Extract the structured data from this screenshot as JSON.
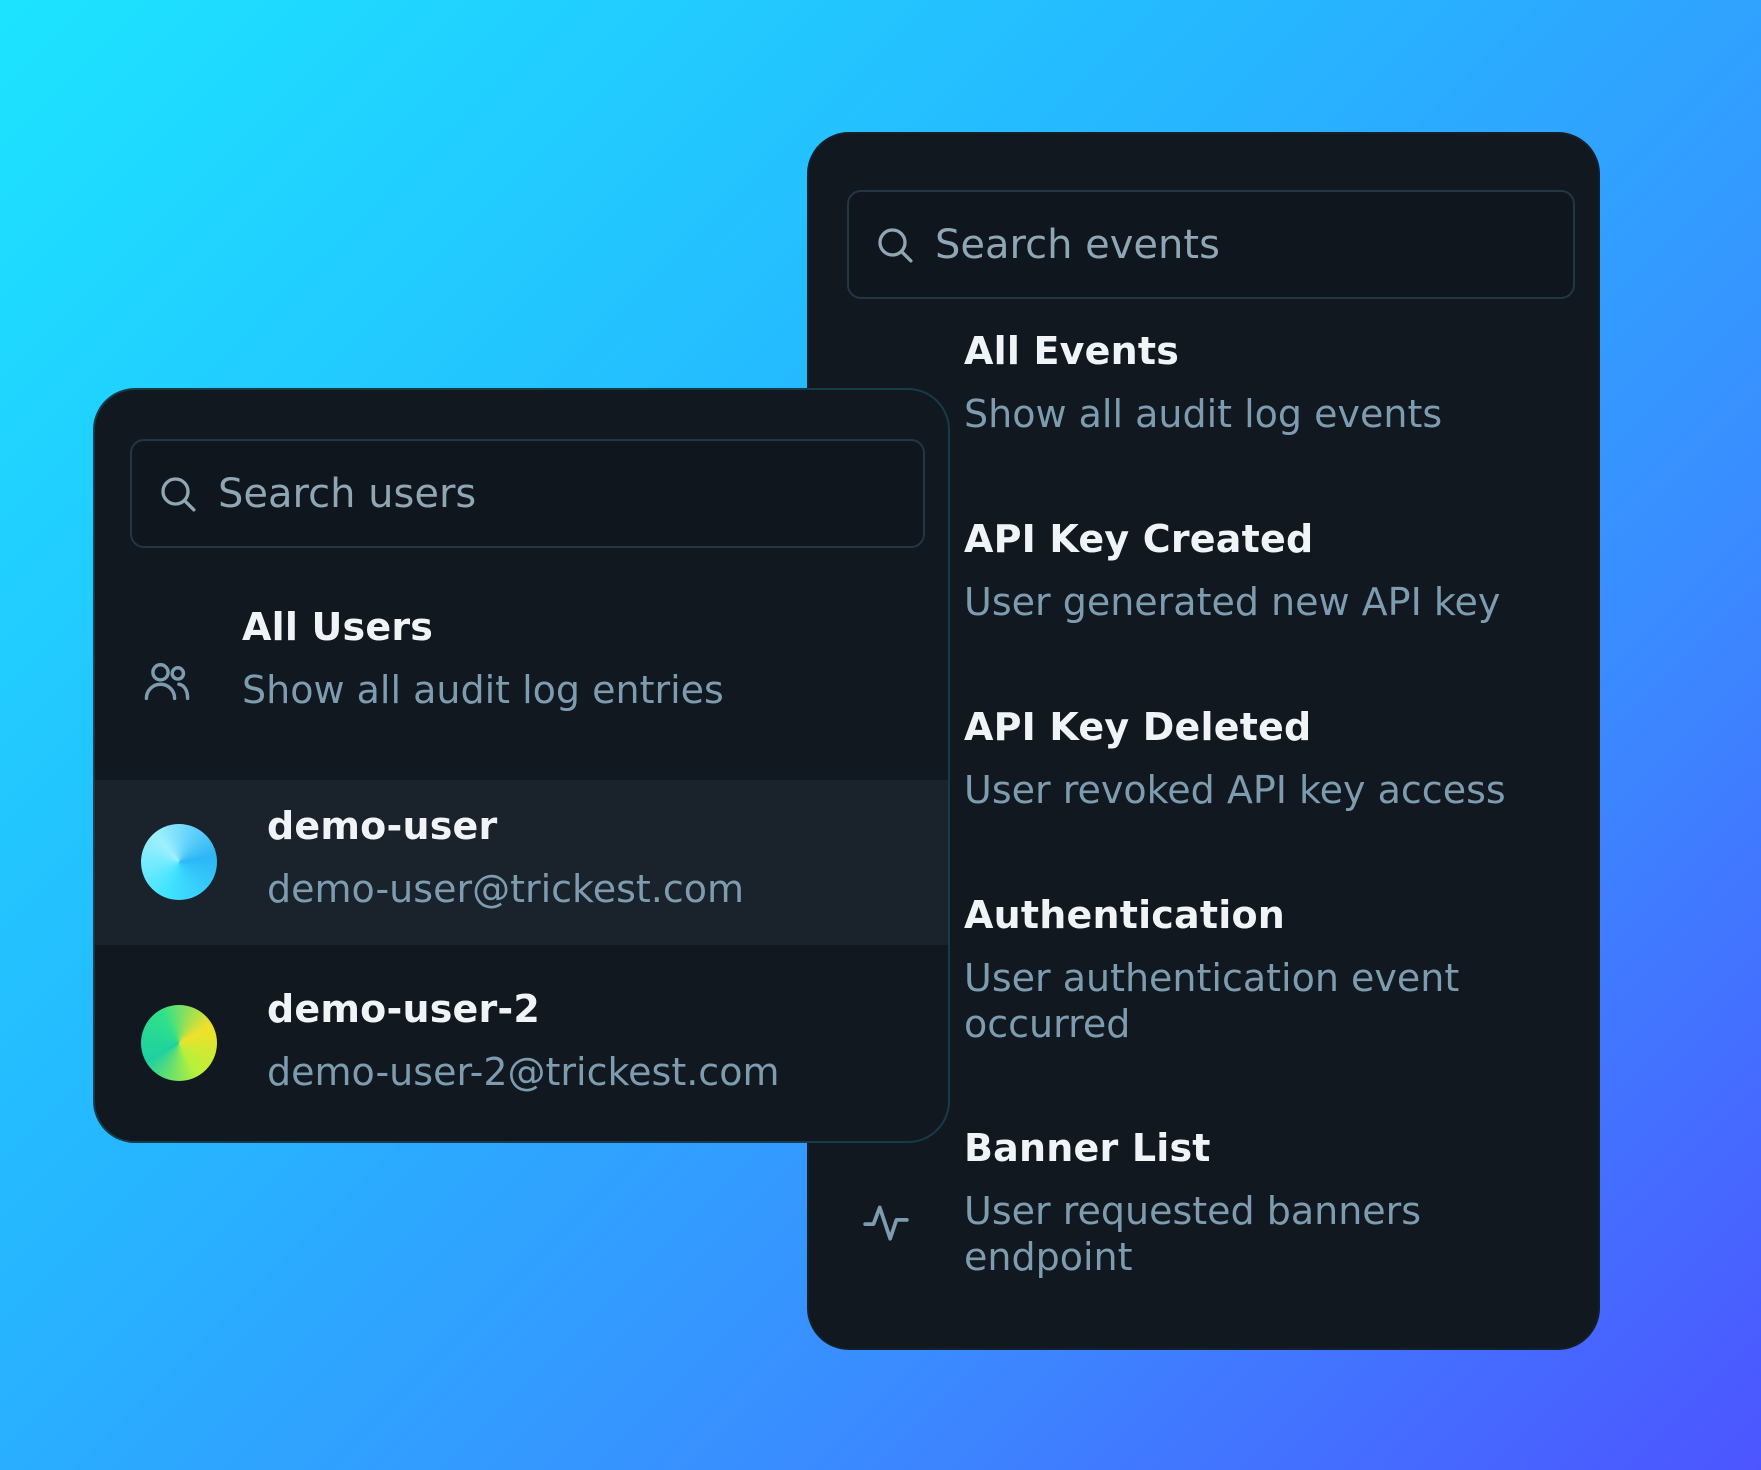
{
  "colors": {
    "panel_bg": "#111820",
    "title_text": "#f1f4f6",
    "desc_text": "#7d9cb0",
    "highlight_row": "#1a222b"
  },
  "events_panel": {
    "search": {
      "placeholder": "Search events",
      "icon": "search-icon"
    },
    "items": [
      {
        "title": "All Events",
        "description": "Show all audit log events"
      },
      {
        "title": "API Key Created",
        "description": "User generated new API key"
      },
      {
        "title": "API Key Deleted",
        "description": "User revoked API key access"
      },
      {
        "title": "Authentication",
        "description": "User authentication event occurred"
      },
      {
        "title": "Banner List",
        "description": "User requested banners endpoint",
        "icon": "activity-icon"
      }
    ]
  },
  "users_panel": {
    "search": {
      "placeholder": "Search users",
      "icon": "search-icon"
    },
    "all_users": {
      "title": "All Users",
      "description": "Show all audit log entries",
      "icon": "users-icon"
    },
    "users": [
      {
        "name": "demo-user",
        "email": "demo-user@trickest.com",
        "selected": true
      },
      {
        "name": "demo-user-2",
        "email": "demo-user-2@trickest.com",
        "selected": false
      }
    ]
  }
}
